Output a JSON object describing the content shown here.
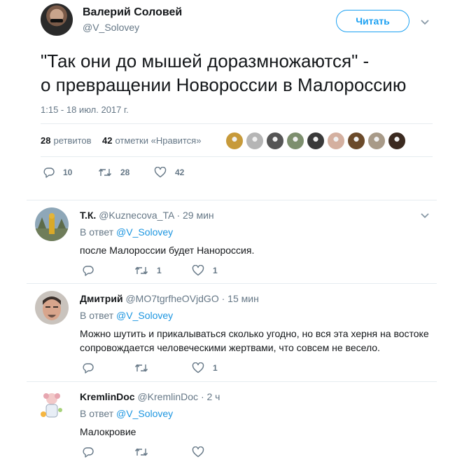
{
  "main_tweet": {
    "author_name": "Валерий Соловей",
    "author_handle": "@V_Solovey",
    "follow_label": "Читать",
    "text_line1": "\"Так они до мышей доразмножаются\" -",
    "text_line2": "о превращении Новороссии в Малороссию",
    "timestamp": "1:15 - 18 июл. 2017 г.",
    "retweets_count": "28",
    "retweets_label": "ретвитов",
    "likes_count": "42",
    "likes_label": "отметки «Нравится»",
    "liker_colors": [
      "#c79a3a",
      "#b5b5b5",
      "#555555",
      "#7d8f6e",
      "#3a3a3a",
      "#d4b0a0",
      "#6b4a2a",
      "#a89a88",
      "#3b2a20"
    ],
    "actions": {
      "reply_count": "10",
      "retweet_count": "28",
      "like_count": "42"
    }
  },
  "replies": [
    {
      "name": "Т.К.",
      "handle": "@Kuznecova_TA",
      "time": "· 29 мин",
      "reply_to_prefix": "В ответ",
      "reply_to_handle": "@V_Solovey",
      "text": "после Малороссии будет Нанороссия.",
      "reply_count": "",
      "retweet_count": "1",
      "like_count": "1"
    },
    {
      "name": "Дмитрий",
      "handle": "@MO7tgrfheOVjdGO",
      "time": "· 15 мин",
      "reply_to_prefix": "В ответ",
      "reply_to_handle": "@V_Solovey",
      "text": "Можно шутить и прикалываться сколько угодно, но вся эта херня на востоке сопровождается человеческими жертвами, что совсем не весело.",
      "reply_count": "",
      "retweet_count": "",
      "like_count": "1"
    },
    {
      "name": "KremlinDoc",
      "handle": "@KremlinDoc",
      "time": "· 2 ч",
      "reply_to_prefix": "В ответ",
      "reply_to_handle": "@V_Solovey",
      "text": "Малокровие",
      "reply_count": "",
      "retweet_count": "",
      "like_count": ""
    }
  ],
  "colors": {
    "accent": "#1da1f2",
    "link": "#1b95e0",
    "muted": "#657786",
    "divider": "#e6ecf0"
  },
  "icons": [
    "chevron-down-icon",
    "reply-icon",
    "retweet-icon",
    "heart-icon"
  ]
}
